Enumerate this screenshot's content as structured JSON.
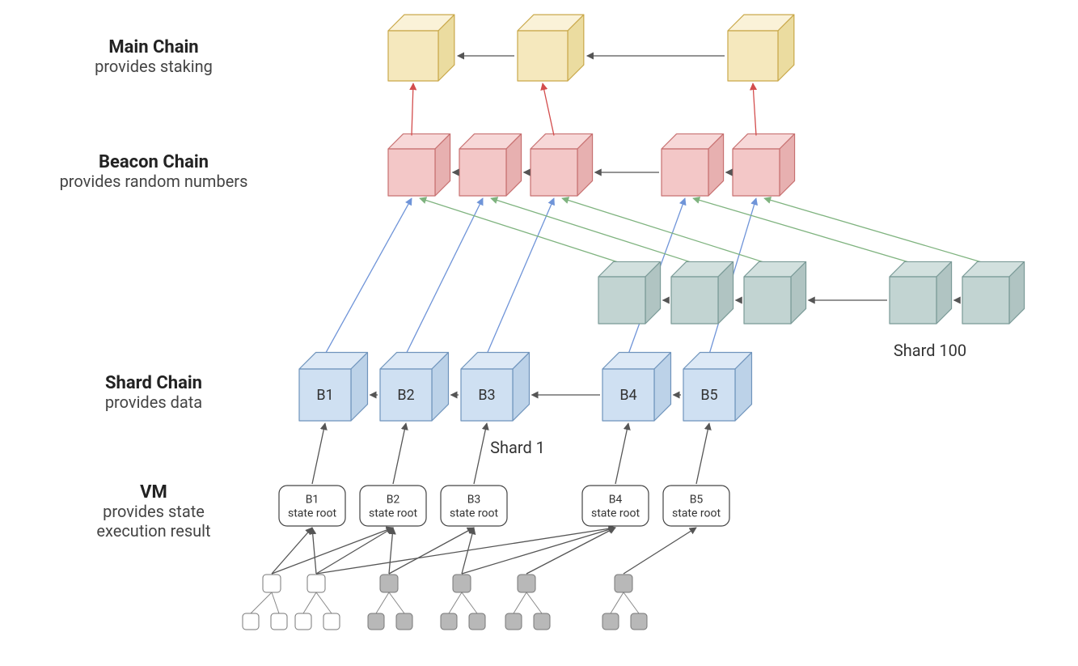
{
  "rows": {
    "main": {
      "title": "Main Chain",
      "subtitle": "provides staking"
    },
    "beacon": {
      "title": "Beacon Chain",
      "subtitle": "provides random numbers"
    },
    "shard": {
      "title": "Shard Chain",
      "subtitle": "provides data"
    },
    "vm": {
      "title": "VM",
      "subtitle1": "provides state",
      "subtitle2": "execution result"
    }
  },
  "shard1_label": "Shard 1",
  "shard100_label": "Shard 100",
  "shard_blocks": [
    "B1",
    "B2",
    "B3",
    "B4",
    "B5"
  ],
  "vm_boxes": [
    {
      "l1": "B1",
      "l2": "state root"
    },
    {
      "l1": "B2",
      "l2": "state root"
    },
    {
      "l1": "B3",
      "l2": "state root"
    },
    {
      "l1": "B4",
      "l2": "state root"
    },
    {
      "l1": "B5",
      "l2": "state root"
    }
  ],
  "colors": {
    "main_fill": "#F5E8BD",
    "main_side": "#EBDCA0",
    "main_top": "#FAF2D8",
    "main_stroke": "#C9A84A",
    "beacon_fill": "#F3C7C7",
    "beacon_side": "#E7B0B0",
    "beacon_top": "#F7D8D8",
    "beacon_stroke": "#C77070",
    "blue_fill": "#CFE0F2",
    "blue_side": "#BCD2E8",
    "blue_top": "#DDE9F6",
    "blue_stroke": "#6F94BC",
    "teal_fill": "#C2D4D2",
    "teal_side": "#B0C4C2",
    "teal_top": "#D2E0DE",
    "teal_stroke": "#7A9A97",
    "red_arrow": "#D34D4D",
    "blue_arrow": "#6F94D8",
    "green_arrow": "#7FB37F",
    "dark_arrow": "#555"
  }
}
